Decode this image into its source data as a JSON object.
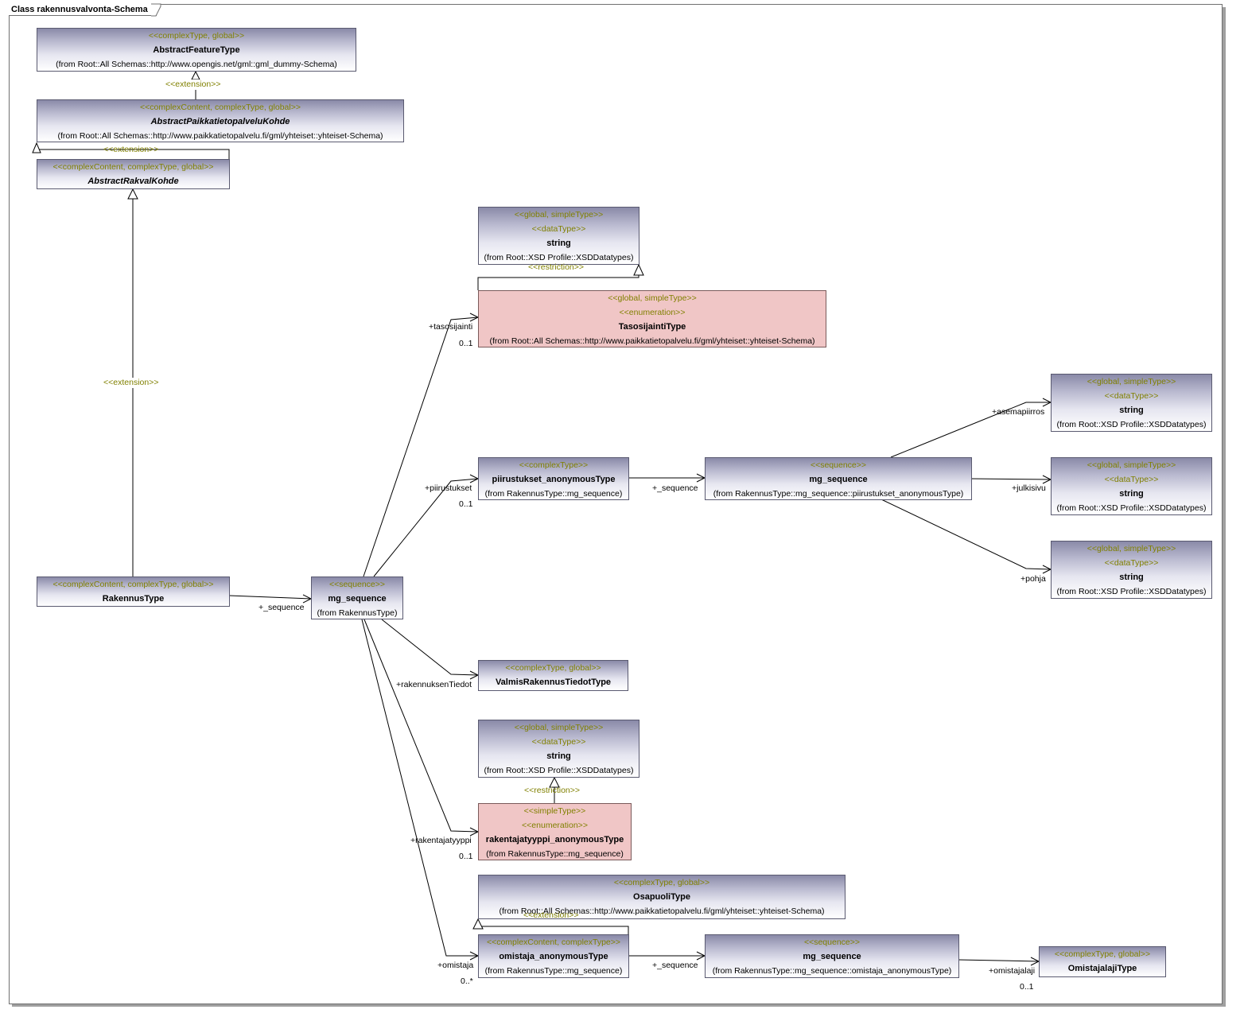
{
  "diagram": {
    "title": "Class rakennusvalvonta-Schema",
    "colors": {
      "stereotype": "#808000",
      "enumeration_fill": "#f0c6c6",
      "class_fill_top": "#8a8aa8"
    },
    "classes": {
      "abstract_feature_type": {
        "stereotypes": [
          "<<complexType, global>>"
        ],
        "name": "AbstractFeatureType",
        "from": "(from Root::All Schemas::http://www.opengis.net/gml::gml_dummy-Schema)"
      },
      "abstract_paikkatietopalvelu_kohde": {
        "stereotypes": [
          "<<complexContent, complexType, global>>"
        ],
        "name": "AbstractPaikkatietopalveluKohde",
        "from": "(from Root::All Schemas::http://www.paikkatietopalvelu.fi/gml/yhteiset::yhteiset-Schema)"
      },
      "abstract_rakval_kohde": {
        "stereotypes": [
          "<<complexContent, complexType, global>>"
        ],
        "name": "AbstractRakvalKohde"
      },
      "rakennus_type": {
        "stereotypes": [
          "<<complexContent, complexType, global>>"
        ],
        "name": "RakennusType"
      },
      "mg_sequence_main": {
        "stereotypes": [
          "<<sequence>>"
        ],
        "name": "mg_sequence",
        "from": "(from RakennusType)"
      },
      "string_top": {
        "stereotypes": [
          "<<global, simpleType>>",
          "<<dataType>>"
        ],
        "name": "string",
        "from": "(from Root::XSD Profile::XSDDatatypes)"
      },
      "tasosijainti_type": {
        "stereotypes": [
          "<<global, simpleType>>",
          "<<enumeration>>"
        ],
        "name": "TasosijaintiType",
        "from": "(from Root::All Schemas::http://www.paikkatietopalvelu.fi/gml/yhteiset::yhteiset-Schema)"
      },
      "piirustukset_anonymous_type": {
        "stereotypes": [
          "<<complexType>>"
        ],
        "name": "piirustukset_anonymousType",
        "from": "(from RakennusType::mg_sequence)"
      },
      "mg_sequence_piirustukset": {
        "stereotypes": [
          "<<sequence>>"
        ],
        "name": "mg_sequence",
        "from": "(from RakennusType::mg_sequence::piirustukset_anonymousType)"
      },
      "string_asemapiirros": {
        "stereotypes": [
          "<<global, simpleType>>",
          "<<dataType>>"
        ],
        "name": "string",
        "from": "(from Root::XSD Profile::XSDDatatypes)"
      },
      "string_julkisivu": {
        "stereotypes": [
          "<<global, simpleType>>",
          "<<dataType>>"
        ],
        "name": "string",
        "from": "(from Root::XSD Profile::XSDDatatypes)"
      },
      "string_pohja": {
        "stereotypes": [
          "<<global, simpleType>>",
          "<<dataType>>"
        ],
        "name": "string",
        "from": "(from Root::XSD Profile::XSDDatatypes)"
      },
      "valmis_rakennus_tiedot_type": {
        "stereotypes": [
          "<<complexType, global>>"
        ],
        "name": "ValmisRakennusTiedotType"
      },
      "string_mid": {
        "stereotypes": [
          "<<global, simpleType>>",
          "<<dataType>>"
        ],
        "name": "string",
        "from": "(from Root::XSD Profile::XSDDatatypes)"
      },
      "rakentajatyyppi_anonymous_type": {
        "stereotypes": [
          "<<simpleType>>",
          "<<enumeration>>"
        ],
        "name": "rakentajatyyppi_anonymousType",
        "from": "(from RakennusType::mg_sequence)"
      },
      "osapuoli_type": {
        "stereotypes": [
          "<<complexType, global>>"
        ],
        "name": "OsapuoliType",
        "from": "(from Root::All Schemas::http://www.paikkatietopalvelu.fi/gml/yhteiset::yhteiset-Schema)"
      },
      "omistaja_anonymous_type": {
        "stereotypes": [
          "<<complexContent, complexType>>"
        ],
        "name": "omistaja_anonymousType",
        "from": "(from RakennusType::mg_sequence)"
      },
      "mg_sequence_omistaja": {
        "stereotypes": [
          "<<sequence>>"
        ],
        "name": "mg_sequence",
        "from": "(from RakennusType::mg_sequence::omistaja_anonymousType)"
      },
      "omistajalaji_type": {
        "stereotypes": [
          "<<complexType, global>>"
        ],
        "name": "OmistajalajiType"
      }
    },
    "relation_stereotypes": {
      "extension_1": "<<extension>>",
      "extension_2": "<<extension>>",
      "extension_3": "<<extension>>",
      "restriction_1": "<<restriction>>",
      "restriction_2": "<<restriction>>",
      "extension_4": "<<extension>>"
    },
    "role_labels": {
      "sequence_main": "+_sequence",
      "tasosijainti": "+tasosijainti",
      "tasosijainti_mult": "0..1",
      "piirustukset": "+piirustukset",
      "piirustukset_mult": "0..1",
      "sequence_piirustukset": "+_sequence",
      "asemapiirros": "+asemapiirros",
      "julkisivu": "+julkisivu",
      "pohja": "+pohja",
      "rakennuksen_tiedot": "+rakennuksenTiedot",
      "rakentajatyyppi": "+rakentajatyyppi",
      "rakentajatyyppi_mult": "0..1",
      "omistaja": "+omistaja",
      "omistaja_mult": "0..*",
      "sequence_omistaja": "+_sequence",
      "omistajalaji": "+omistajalaji",
      "omistajalaji_mult": "0..1"
    }
  }
}
